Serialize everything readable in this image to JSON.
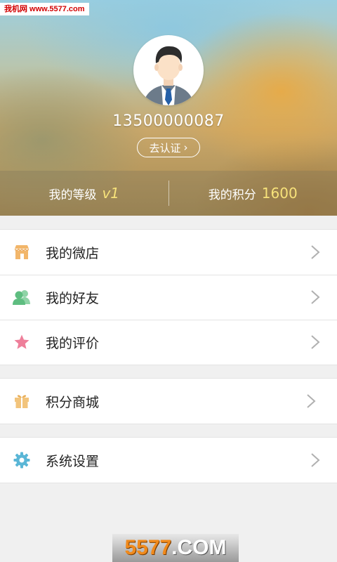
{
  "watermark_top": "我机网 www.5577.com",
  "profile": {
    "phone": "13500000087",
    "verify_label": "去认证",
    "verify_arrow": "›"
  },
  "stats": {
    "level_label": "我的等级",
    "level_value": "v1",
    "points_label": "我的积分",
    "points_value": "1600"
  },
  "menu_groups": [
    [
      {
        "label": "我的微店",
        "icon": "store-icon",
        "color": "#f2b66a"
      },
      {
        "label": "我的好友",
        "icon": "friends-icon",
        "color": "#6cc58e"
      },
      {
        "label": "我的评价",
        "icon": "star-icon",
        "color": "#ee7f9a"
      }
    ],
    [
      {
        "label": "积分商城",
        "icon": "gift-icon",
        "color": "#f2c47c"
      }
    ],
    [
      {
        "label": "系统设置",
        "icon": "gear-icon",
        "color": "#5ab6d6"
      }
    ]
  ],
  "watermark_bottom": {
    "number": "5577",
    "domain": ".COM"
  }
}
